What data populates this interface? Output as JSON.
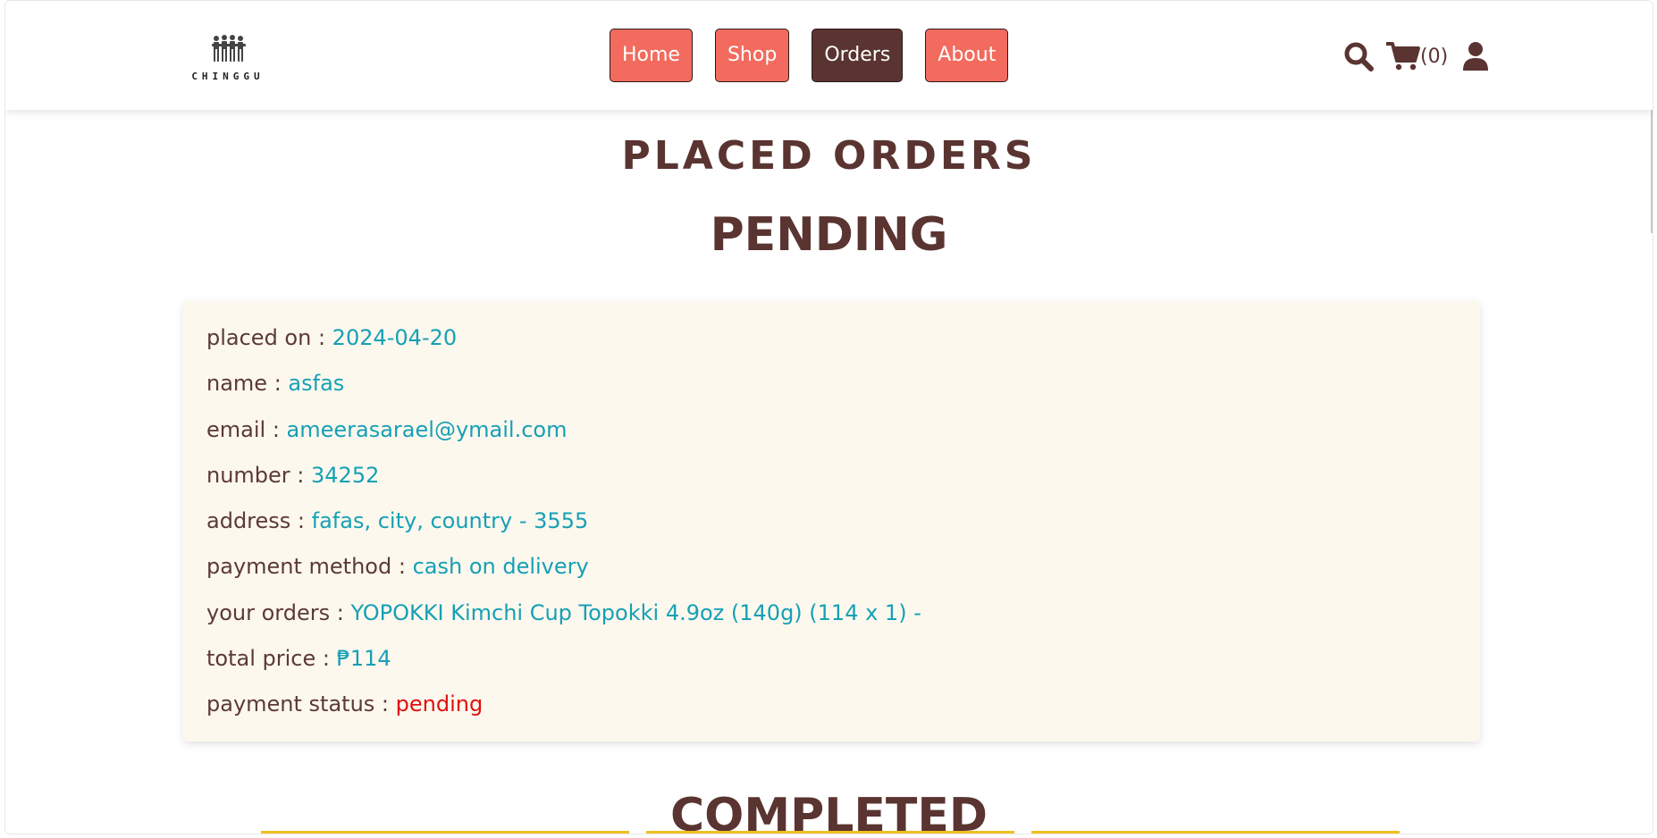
{
  "header": {
    "logo_text": "CHINGGU",
    "nav": [
      {
        "label": "Home",
        "active": false
      },
      {
        "label": "Shop",
        "active": false
      },
      {
        "label": "Orders",
        "active": true
      },
      {
        "label": "About",
        "active": false
      }
    ],
    "icons": [
      "search-icon",
      "cart-icon",
      "user-icon"
    ],
    "cart_count": "(0)"
  },
  "page": {
    "title": "PLACED ORDERS",
    "pending_heading": "PENDING",
    "completed_heading": "COMPLETED"
  },
  "order": {
    "fields": [
      {
        "label": "placed on : ",
        "value": "2024-04-20"
      },
      {
        "label": "name : ",
        "value": "asfas"
      },
      {
        "label": "email : ",
        "value": "ameerasarael@ymail.com"
      },
      {
        "label": "number : ",
        "value": "34252"
      },
      {
        "label": "address : ",
        "value": "fafas, city, country - 3555"
      },
      {
        "label": "payment method : ",
        "value": "cash on delivery"
      },
      {
        "label": "your orders : ",
        "value": "YOPOKKI Kimchi Cup Topokki 4.9oz (140g) (114 x 1) -"
      },
      {
        "label": "total price : ",
        "value": "₱114"
      },
      {
        "label": "payment status : ",
        "value": "pending"
      }
    ]
  },
  "colors": {
    "brand_coral": "#f26b5e",
    "brand_brown": "#5a3431",
    "value_teal": "#16a0b5",
    "status_red": "#e01010",
    "card_bg": "#fdf8ee"
  }
}
